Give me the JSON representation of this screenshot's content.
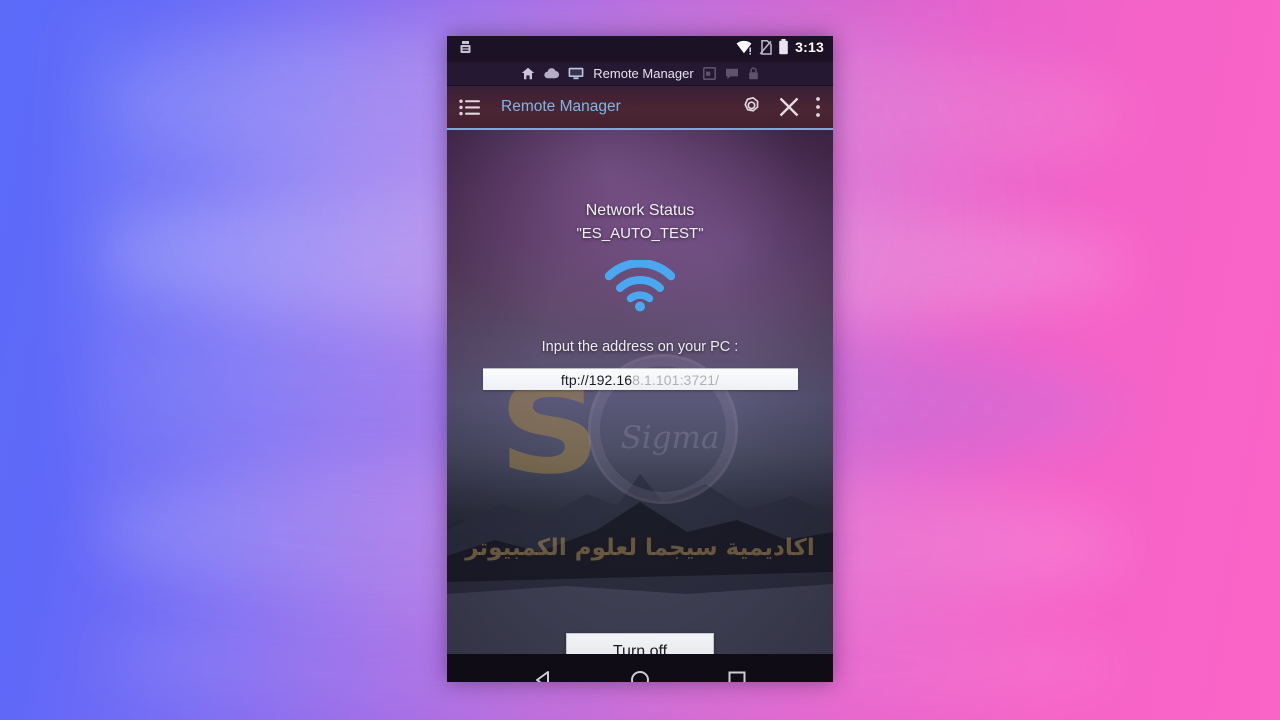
{
  "background": {
    "gradient_from": "#5b6cf9",
    "gradient_to": "#fa64c6",
    "description": "waving-flag-blue-to-pink-gradient"
  },
  "phone": {
    "status_bar": {
      "left_icons": [
        "usb-debug-icon"
      ],
      "right_icons": [
        "wifi-warning-icon",
        "no-sim-icon",
        "battery-icon"
      ],
      "time": "3:13"
    },
    "breadcrumb_bar": {
      "items": [
        {
          "icon": "home-icon",
          "label": "",
          "dimmed": false
        },
        {
          "icon": "cloud-icon",
          "label": "",
          "dimmed": false
        },
        {
          "icon": "monitor-icon",
          "label": "Remote Manager",
          "dimmed": false
        },
        {
          "icon": "window-icon",
          "label": "",
          "dimmed": true
        },
        {
          "icon": "chat-icon",
          "label": "",
          "dimmed": true
        },
        {
          "icon": "lock-icon",
          "label": "",
          "dimmed": true
        }
      ]
    },
    "toolbar": {
      "menu_icon": "list-menu-icon",
      "title": "Remote Manager",
      "settings_icon": "gear-icon",
      "close_icon": "close-icon",
      "overflow_icon": "more-vertical-icon",
      "accent_color": "#7fb6e8"
    },
    "main": {
      "network_status_label": "Network Status",
      "ssid": "\"ES_AUTO_TEST\"",
      "wifi_icon": "wifi-signal-icon",
      "wifi_icon_color": "#4aa8f0",
      "prompt": "Input the address on your PC :",
      "address_visible": "ftp://192.16",
      "address_masked": "8.1.101:3721/",
      "address_full": "ftp://192.168.1.101:3721/",
      "turn_off_label": "Turn off"
    },
    "watermark": {
      "logo_text": "S",
      "signature_text": "Sigma",
      "arabic_text": "اكاديمية سيجما لعلوم الكمبيوتر"
    },
    "nav_bar": {
      "back_icon": "back-triangle-icon",
      "home_icon": "home-circle-icon",
      "recents_icon": "recents-square-icon"
    }
  }
}
